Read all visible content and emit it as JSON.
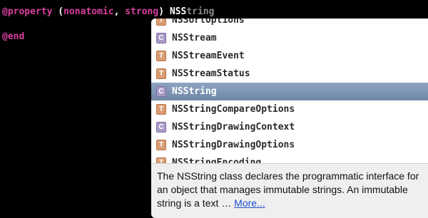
{
  "editor": {
    "line1": {
      "kw_property": "@property",
      "attrs_open": " (",
      "kw_nonatomic": "nonatomic",
      "comma": ", ",
      "kw_strong": "strong",
      "attrs_close": ") ",
      "typed": "NSS",
      "ghost": "tring"
    },
    "line2": {
      "kw_end": "@end"
    }
  },
  "completion": {
    "items": [
      {
        "kind": "T",
        "label": "NSSortOptions"
      },
      {
        "kind": "C",
        "label": "NSStream"
      },
      {
        "kind": "T",
        "label": "NSStreamEvent"
      },
      {
        "kind": "T",
        "label": "NSStreamStatus"
      },
      {
        "kind": "C",
        "label": "NSString",
        "selected": true
      },
      {
        "kind": "T",
        "label": "NSStringCompareOptions"
      },
      {
        "kind": "C",
        "label": "NSStringDrawingContext"
      },
      {
        "kind": "T",
        "label": "NSStringDrawingOptions"
      },
      {
        "kind": "T",
        "label": "NSStringEncoding"
      }
    ],
    "description": "The NSString class declares the programmatic interface for an object that manages immutable strings. An immutable string is a text … ",
    "more_link": "More..."
  },
  "colors": {
    "keyword": "#d93fa0",
    "selection": "#7c93b2",
    "type_badge": "#d99c72",
    "class_badge": "#a99ac6",
    "link": "#1f4fd0"
  }
}
